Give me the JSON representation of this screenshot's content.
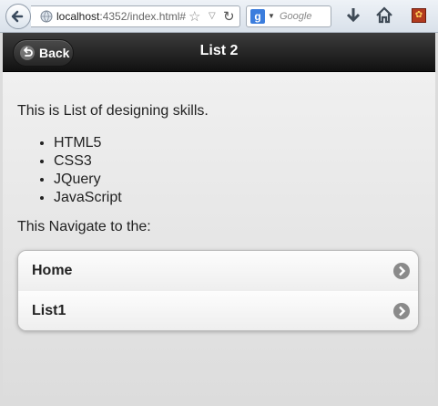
{
  "browser": {
    "url_host": "localhost",
    "url_rest": ":4352/index.html#",
    "search_placeholder": "Google",
    "search_engine_icon": "g"
  },
  "header": {
    "back_label": "Back",
    "title": "List 2"
  },
  "content": {
    "intro": "This is List of designing skills.",
    "skills": [
      "HTML5",
      "CSS3",
      "JQuery",
      "JavaScript"
    ],
    "navigate_text": "This Navigate to the:",
    "nav_items": [
      "Home",
      "List1"
    ]
  }
}
